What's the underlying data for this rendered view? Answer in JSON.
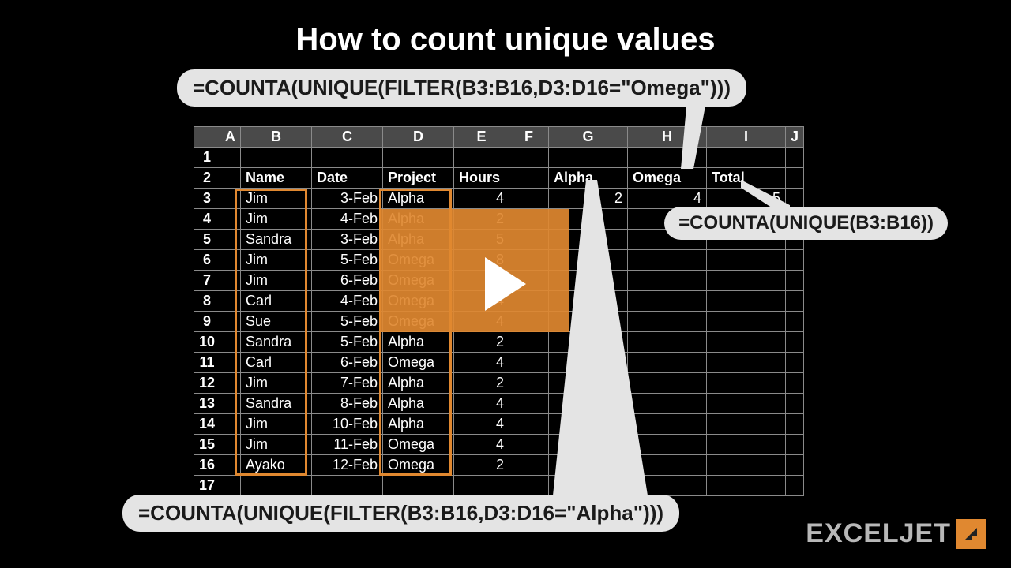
{
  "title": "How to count unique values",
  "formulas": {
    "top": "=COUNTA(UNIQUE(FILTER(B3:B16,D3:D16=\"Omega\")))",
    "right": "=COUNTA(UNIQUE(B3:B16))",
    "bottom": "=COUNTA(UNIQUE(FILTER(B3:B16,D3:D16=\"Alpha\")))"
  },
  "columns": [
    "A",
    "B",
    "C",
    "D",
    "E",
    "F",
    "G",
    "H",
    "I",
    "J"
  ],
  "headers": {
    "name": "Name",
    "date": "Date",
    "project": "Project",
    "hours": "Hours",
    "alpha": "Alpha",
    "omega": "Omega",
    "total": "Total"
  },
  "results": {
    "alpha": "2",
    "omega": "4",
    "total": "5"
  },
  "rows": [
    {
      "n": "1"
    },
    {
      "n": "2",
      "header": true
    },
    {
      "n": "3",
      "name": "Jim",
      "date": "3-Feb",
      "project": "Alpha",
      "hours": "4",
      "results": true
    },
    {
      "n": "4",
      "name": "Jim",
      "date": "4-Feb",
      "project": "Alpha",
      "hours": "2"
    },
    {
      "n": "5",
      "name": "Sandra",
      "date": "3-Feb",
      "project": "Alpha",
      "hours": "5"
    },
    {
      "n": "6",
      "name": "Jim",
      "date": "5-Feb",
      "project": "Omega",
      "hours": "8"
    },
    {
      "n": "7",
      "name": "Jim",
      "date": "6-Feb",
      "project": "Omega",
      "hours": "8"
    },
    {
      "n": "8",
      "name": "Carl",
      "date": "4-Feb",
      "project": "Omega",
      "hours": "4"
    },
    {
      "n": "9",
      "name": "Sue",
      "date": "5-Feb",
      "project": "Omega",
      "hours": "4"
    },
    {
      "n": "10",
      "name": "Sandra",
      "date": "5-Feb",
      "project": "Alpha",
      "hours": "2"
    },
    {
      "n": "11",
      "name": "Carl",
      "date": "6-Feb",
      "project": "Omega",
      "hours": "4"
    },
    {
      "n": "12",
      "name": "Jim",
      "date": "7-Feb",
      "project": "Alpha",
      "hours": "2"
    },
    {
      "n": "13",
      "name": "Sandra",
      "date": "8-Feb",
      "project": "Alpha",
      "hours": "4"
    },
    {
      "n": "14",
      "name": "Jim",
      "date": "10-Feb",
      "project": "Alpha",
      "hours": "4"
    },
    {
      "n": "15",
      "name": "Jim",
      "date": "11-Feb",
      "project": "Omega",
      "hours": "4"
    },
    {
      "n": "16",
      "name": "Ayako",
      "date": "12-Feb",
      "project": "Omega",
      "hours": "2"
    },
    {
      "n": "17"
    }
  ],
  "logo": "EXCELJET",
  "chart_data": {
    "type": "table",
    "title": "How to count unique values",
    "columns": [
      "Name",
      "Date",
      "Project",
      "Hours"
    ],
    "rows": [
      [
        "Jim",
        "3-Feb",
        "Alpha",
        4
      ],
      [
        "Jim",
        "4-Feb",
        "Alpha",
        2
      ],
      [
        "Sandra",
        "3-Feb",
        "Alpha",
        5
      ],
      [
        "Jim",
        "5-Feb",
        "Omega",
        8
      ],
      [
        "Jim",
        "6-Feb",
        "Omega",
        8
      ],
      [
        "Carl",
        "4-Feb",
        "Omega",
        4
      ],
      [
        "Sue",
        "5-Feb",
        "Omega",
        4
      ],
      [
        "Sandra",
        "5-Feb",
        "Alpha",
        2
      ],
      [
        "Carl",
        "6-Feb",
        "Omega",
        4
      ],
      [
        "Jim",
        "7-Feb",
        "Alpha",
        2
      ],
      [
        "Sandra",
        "8-Feb",
        "Alpha",
        4
      ],
      [
        "Jim",
        "10-Feb",
        "Alpha",
        4
      ],
      [
        "Jim",
        "11-Feb",
        "Omega",
        4
      ],
      [
        "Ayako",
        "12-Feb",
        "Omega",
        2
      ]
    ],
    "summary": {
      "Alpha": 2,
      "Omega": 4,
      "Total": 5
    }
  }
}
